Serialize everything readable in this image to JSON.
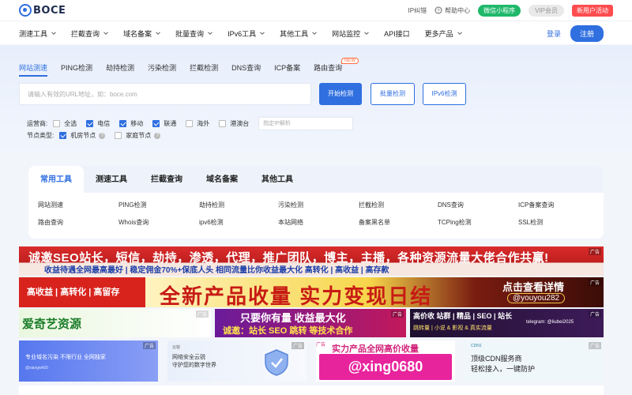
{
  "brand": {
    "name": "BOCE"
  },
  "topbar": {
    "ip_report": "IP纠错",
    "help": "帮助中心",
    "mini_program": "微信小程序",
    "vip": "VIP会员",
    "new_user": "新用户活动"
  },
  "nav": {
    "items": [
      "测速工具",
      "拦截查询",
      "域名备案",
      "批量查询",
      "IPv6工具",
      "其他工具",
      "网站监控",
      "API接口",
      "更多产品"
    ],
    "login": "登录",
    "register": "注册"
  },
  "hero": {
    "tabs": [
      "网站测速",
      "PING检测",
      "劫持检测",
      "污染检测",
      "拦截检测",
      "DNS查询",
      "ICP备案",
      "路由查询"
    ],
    "new_badge": "NEW",
    "search_placeholder": "请输入有效的URL地址，如：boce.com",
    "start_button": "开始检测",
    "batch_button": "批量检测",
    "ipv6_button": "IPv6检测",
    "operator_label": "运营商:",
    "operators": [
      {
        "label": "全选",
        "checked": false
      },
      {
        "label": "电信",
        "checked": true
      },
      {
        "label": "移动",
        "checked": true
      },
      {
        "label": "联通",
        "checked": true
      },
      {
        "label": "海外",
        "checked": false
      },
      {
        "label": "港澳台",
        "checked": false
      }
    ],
    "ip_placeholder": "指定IP解析",
    "node_label": "节点类型:",
    "nodes": [
      {
        "label": "机房节点",
        "checked": true
      },
      {
        "label": "家庭节点",
        "checked": false
      }
    ]
  },
  "tools": {
    "tabs": [
      "常用工具",
      "测速工具",
      "拦截查询",
      "域名备案",
      "其他工具"
    ],
    "row1": [
      "网站测速",
      "PING检测",
      "劫持检测",
      "污染检测",
      "拦截检测",
      "DNS查询",
      "ICP备案查询"
    ],
    "row2": [
      "路由查询",
      "Whois查询",
      "ipv6检测",
      "本站网络",
      "备案黑名单",
      "TCPing检测",
      "SSL检测"
    ]
  },
  "ads": {
    "tag": "广告",
    "a1_line1": "诚邀SEO站长，短信，劫持，渗透，代理，推广团队，博主，主播，各种资源流量大佬合作共赢!",
    "a1_line2": "收益待遇全网最高最好 | 稳定佣金70%+保底人头        相同流量比你收益最大化  高转化 | 高收益 | 高存款",
    "a2_left": "高收益 | 高转化 | 高留存",
    "a2_mid": "全新产品收量  实力变现日结",
    "a2_r1": "点击查看详情",
    "a2_r2": "@youyou282",
    "a3": "爱奇艺资源",
    "a4_line1": "只要你有量 收益最大化",
    "a4_line2": "诚邀：站长 SEO 跳转 等技术合作",
    "a5_line1": "高价收 站群 | 精品 | SEO | 站长",
    "a5_line2": "跳转量 | 小说 & 影视 & 真实流量",
    "a5_line3": "telegram: @liubei2025",
    "a6_line1": "专业域名污染 不限行业 全网独家",
    "a6_line2": "@xiangwh50",
    "a7_brand": "云锐",
    "a7_line1": "网络安全云锐",
    "a7_line2": "守护您的数字世界",
    "a8_line1": "实力产品全网高价收量",
    "a8_line2": "@xing0680",
    "a9_brand": "CDN1",
    "a9_line1": "顶级CDN服务商",
    "a9_line2": "轻松接入，一键防护"
  }
}
